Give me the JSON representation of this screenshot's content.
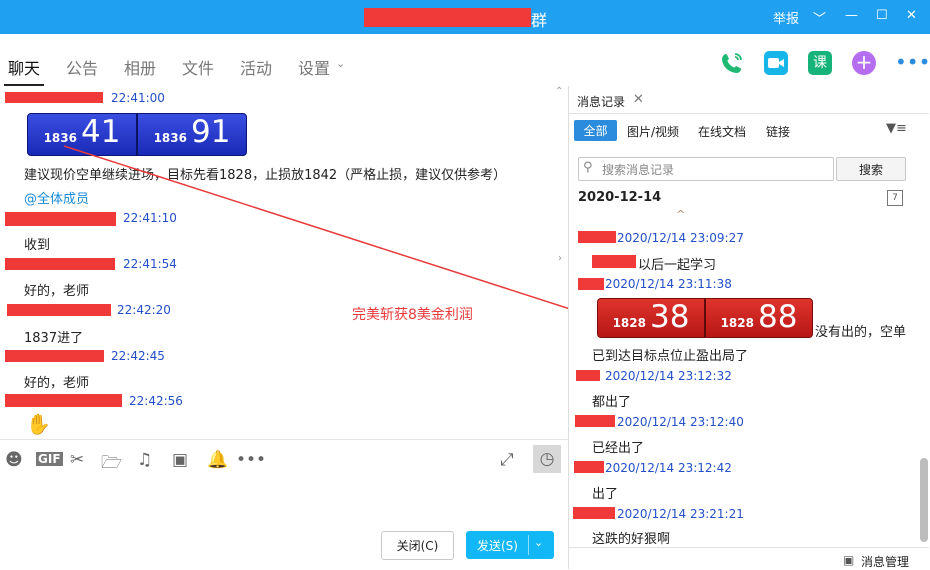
{
  "window": {
    "title_suffix": "群",
    "report": "举报",
    "controls": [
      "﹀",
      "—",
      "☐",
      "✕"
    ]
  },
  "tabs": [
    "聊天",
    "公告",
    "相册",
    "文件",
    "活动",
    "设置"
  ],
  "tabs_dropdown_icon": "chevron-down-icon",
  "top_icons": [
    "phone-icon",
    "video-icon",
    "lesson-icon",
    "plus-icon",
    "more-icon"
  ],
  "chat": {
    "messages": [
      {
        "time": "22:41:00"
      },
      {
        "time": "22:41:10",
        "text": "收到"
      },
      {
        "time": "22:41:54",
        "text": "好的，老师"
      },
      {
        "time": "22:42:20",
        "text": "1837进了"
      },
      {
        "time": "22:42:45",
        "text": "好的，老师"
      },
      {
        "time": "22:42:56"
      }
    ],
    "ticker_blue": {
      "left_small": "1836",
      "left_big": "41",
      "right_small": "1836",
      "right_big": "91"
    },
    "advice_text": "建议现价空单继续进场，目标先看1828，止损放1842（严格止损，建议仅供参考）",
    "mention": "@全体成员",
    "annotation": "完美斩获8美金利润"
  },
  "toolbar_icons": [
    "emoji-icon",
    "gif-icon",
    "scissors-icon",
    "folder-icon",
    "music-icon",
    "image-icon",
    "bell-icon",
    "more-icon",
    "expand-icon",
    "history-clock-icon"
  ],
  "buttons": {
    "close": "关闭(C)",
    "send": "发送(S)"
  },
  "history": {
    "tab_label": "消息记录",
    "filters": [
      "全部",
      "图片/视频",
      "在线文档",
      "链接"
    ],
    "search_placeholder": "搜索消息记录",
    "search_button": "搜索",
    "date": "2020-12-14",
    "entries": [
      {
        "time": "2020/12/14 23:09:27",
        "text": "以后一起学习"
      },
      {
        "time": "2020/12/14 23:11:38"
      },
      {
        "time": "2020/12/14 23:12:32",
        "text": "都出了"
      },
      {
        "time": "2020/12/14 23:12:40",
        "text": "已经出了"
      },
      {
        "time": "2020/12/14 23:12:42",
        "text": "出了"
      },
      {
        "time": "2020/12/14 23:21:21",
        "text": "这跌的好狠啊"
      }
    ],
    "ticker_red": {
      "left_small": "1828",
      "left_big": "38",
      "right_small": "1828",
      "right_big": "88"
    },
    "ticker_caption": "没有出的，空单",
    "target_text": "已到达目标点位止盈出局了",
    "management": "消息管理"
  },
  "colors": {
    "titlebar": "#20a0f0",
    "redact": "#f03a3a",
    "time_blue": "#2350c8",
    "send": "#12b7f5",
    "annotation": "#e83a3a"
  }
}
